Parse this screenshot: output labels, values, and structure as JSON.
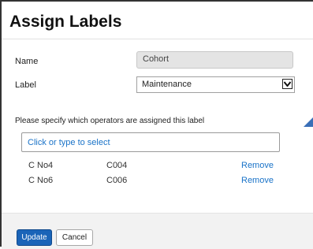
{
  "dialog": {
    "title": "Assign Labels"
  },
  "form": {
    "name_label": "Name",
    "name_value": "Cohort",
    "label_label": "Label",
    "label_value": "Maintenance",
    "instructions": "Please specify which operators are assigned this label",
    "typeahead_placeholder": "Click or type to select"
  },
  "operators": [
    {
      "name": "C No4",
      "code": "C004",
      "action": "Remove"
    },
    {
      "name": "C No6",
      "code": "C006",
      "action": "Remove"
    }
  ],
  "footer": {
    "update_label": "Update",
    "cancel_label": "Cancel"
  },
  "colors": {
    "link": "#1a73c8",
    "primary_button": "#1a64b8",
    "accent_triangle": "#3a6fb7"
  }
}
